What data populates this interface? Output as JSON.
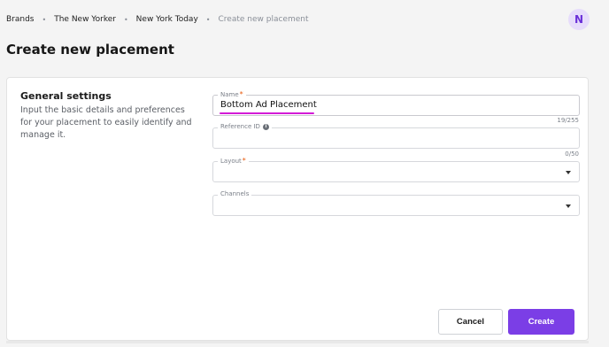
{
  "breadcrumb": {
    "items": [
      "Brands",
      "The New Yorker",
      "New York Today"
    ],
    "current": "Create new placement",
    "separator": "•"
  },
  "user": {
    "avatar_initial": "N"
  },
  "page": {
    "title": "Create new placement"
  },
  "general": {
    "title": "General settings",
    "description": "Input the basic details and preferences for your placement to easily identify and manage it."
  },
  "fields": {
    "name": {
      "label": "Name",
      "required": "*",
      "value": "Bottom Ad Placement",
      "counter": "19/255"
    },
    "reference": {
      "label": "Reference ID",
      "value": "",
      "counter": "0/50"
    },
    "layout": {
      "label": "Layout",
      "required": "*",
      "value": ""
    },
    "channels": {
      "label": "Channels",
      "value": ""
    }
  },
  "actions": {
    "cancel": "Cancel",
    "create": "Create"
  },
  "colors": {
    "primary": "#7b3ee6",
    "required": "#e8590c",
    "highlight": "#d31bd6",
    "avatar_bg": "#e6dcfb"
  }
}
